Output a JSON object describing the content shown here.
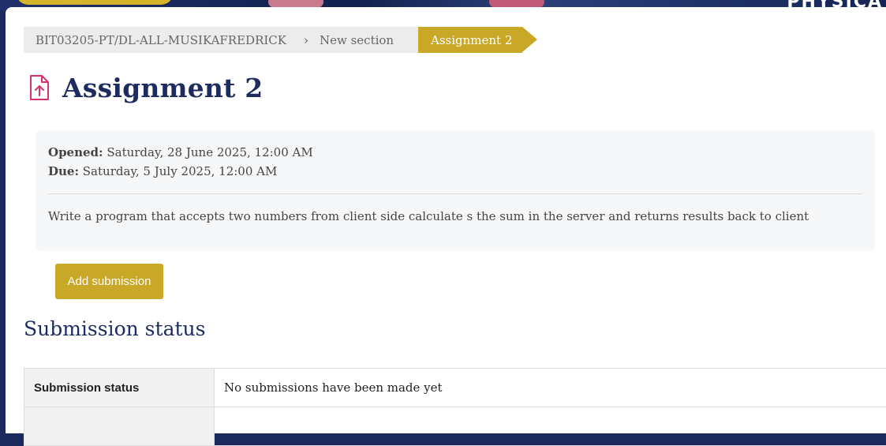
{
  "banner": {
    "text": "PHYSICA"
  },
  "breadcrumb": {
    "course": "BIT03205-PT/DL-ALL-MUSIKAFREDRICK",
    "separator": "›",
    "section": "New section",
    "current": "Assignment 2"
  },
  "page": {
    "title": "Assignment 2",
    "icon": "assignment-upload-icon"
  },
  "dates": {
    "opened_label": "Opened:",
    "opened_value": "Saturday, 28 June 2025, 12:00 AM",
    "due_label": "Due:",
    "due_value": "Saturday, 5 July 2025, 12:00 AM"
  },
  "description": "Write a program that accepts two numbers from client side calculate s the sum in the server and returns results back to client",
  "actions": {
    "add_submission": "Add submission"
  },
  "submission_status": {
    "heading": "Submission status",
    "rows": [
      {
        "label": "Submission status",
        "value": "No submissions have been made yet"
      },
      {
        "label": "",
        "value": ""
      }
    ]
  },
  "colors": {
    "accent": "#c9a828",
    "title": "#1d2b5e",
    "icon": "#d6336c"
  }
}
